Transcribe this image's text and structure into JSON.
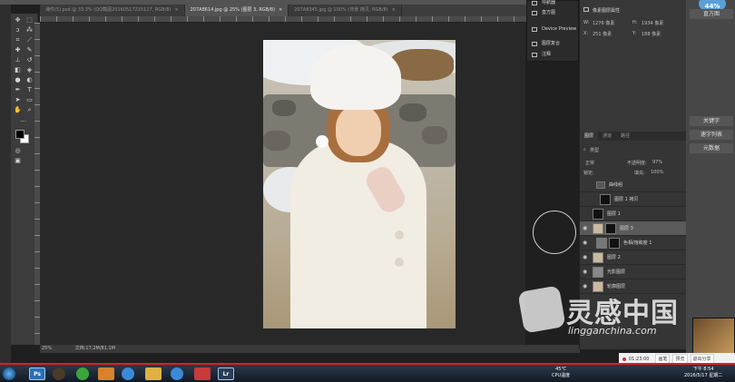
{
  "doc_tabs": [
    {
      "label": "课件(5).psd @ 33.3% (QQ截图20160517215127, RGB/8)",
      "active": false
    },
    {
      "label": "207A8614.jpg @ 25% (图层 3, RGB/8)",
      "active": true
    },
    {
      "label": "207A8345.jpg @ 100% (背景 拷贝, RGB/8)",
      "active": false
    }
  ],
  "tab_close": "×",
  "dropdown_menu": {
    "items": [
      "导航器",
      "直方图",
      "Device Preview",
      "图层复合",
      "注释"
    ]
  },
  "properties": {
    "title": "像素图层属性",
    "w_label": "W:",
    "w_value": "1276 像素",
    "h_label": "H:",
    "h_value": "1934 像素",
    "x_label": "X:",
    "x_value": "251 像素",
    "y_label": "Y:",
    "y_value": "188 像素"
  },
  "layers_panel": {
    "tabs": [
      "图层",
      "通道",
      "路径"
    ],
    "filter_kind": "类型",
    "blend_mode": "正常",
    "opacity_label": "不透明度:",
    "opacity_value": "97%",
    "lock_label": "锁定:",
    "fill_label": "填充:",
    "fill_value": "100%",
    "layers": [
      {
        "name": "曲线组",
        "selected": false
      },
      {
        "name": "图层 1 拷贝",
        "selected": false
      },
      {
        "name": "图层 1",
        "selected": false
      },
      {
        "name": "图层 3",
        "selected": true
      },
      {
        "name": "色相/饱和度 1",
        "selected": false
      },
      {
        "name": "图层 2",
        "selected": false
      },
      {
        "name": "光影图层",
        "selected": false
      },
      {
        "name": "轮廓图层",
        "selected": false
      }
    ]
  },
  "far_right": {
    "cpu_percent": "44%",
    "items": [
      "直方图",
      "关键字",
      "速字列表",
      "元数据"
    ]
  },
  "status": {
    "zoom": "25%",
    "doc_size": "文档:17.2M/81.1M"
  },
  "watermark": {
    "brand_cn": "灵感中国",
    "url": "lingganchina.com"
  },
  "player": {
    "time": "01:23:00",
    "buttons": [
      "画笔",
      "预览",
      "退出分享"
    ]
  },
  "taskbar": {
    "ps_icon": "Ps",
    "lr_icon": "Lr",
    "temp": "45℃",
    "cpu_temp": "CPU温度",
    "time": "下午 8:54",
    "date": "2016/5/17 星期二"
  },
  "colors": {
    "accent_red": "#d92020",
    "ps_blue": "#2d6fb5",
    "cpu_badge": "#5aa0d8"
  }
}
